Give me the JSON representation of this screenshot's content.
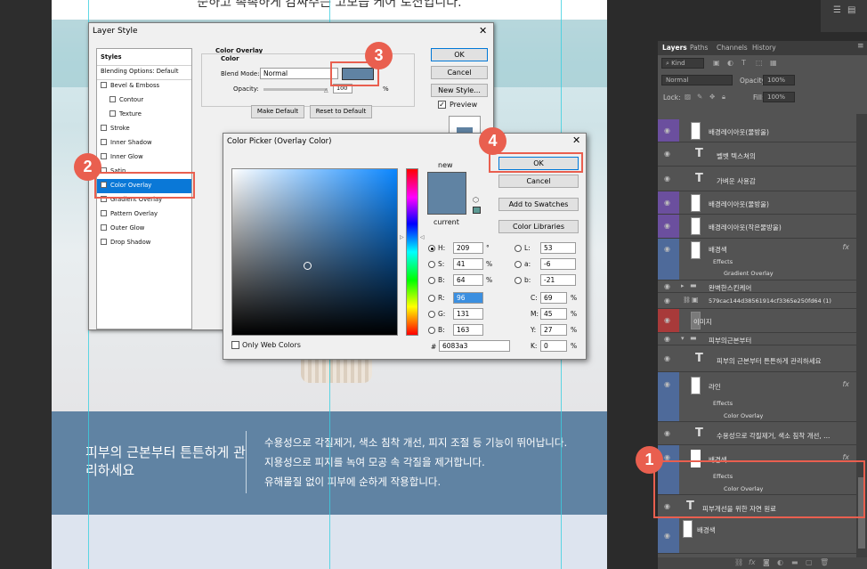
{
  "canvas": {
    "top_caption": "순하고 촉촉하게 감싸주는 고보습 케어 로션입니다.",
    "band_title": "피부의 근본부터 튼튼하게 관리하세요",
    "band_text": [
      "수용성으로 각질제거, 색소 침착 개선, 피지 조절 등 기능이 뛰어납니다.",
      "지용성으로 피지를 녹여 모공 속 각질을 제거합니다.",
      "유해물질 없이 피부에 순하게 작용합니다."
    ],
    "band_color": "#6083a3"
  },
  "layers_panel": {
    "tabs": [
      "Layers",
      "Paths",
      "Channels",
      "History"
    ],
    "kind_label": "Kind",
    "blend_mode": "Normal",
    "opacity_label": "Opacity:",
    "opacity_value": "100%",
    "lock_label": "Lock:",
    "fill_label": "Fill:",
    "fill_value": "100%",
    "layers": [
      {
        "name": "배경레이아웃(물방울)",
        "kind": "pixel",
        "stripe": "#6b4f9e"
      },
      {
        "name": "벨벳 텍스쳐의",
        "kind": "text"
      },
      {
        "name": "가벼운 사용감",
        "kind": "text"
      },
      {
        "name": "배경레이아웃(물방울)",
        "kind": "pixel",
        "stripe": "#6b4f9e"
      },
      {
        "name": "배경레이아웃(작은물방울)",
        "kind": "pixel",
        "stripe": "#6b4f9e"
      },
      {
        "name": "배경색",
        "kind": "pixel",
        "stripe": "#4e6a9a",
        "fx": "fx",
        "effects_label": "Effects",
        "effect": "Gradient Overlay"
      },
      {
        "name": "완벽한스킨케어",
        "kind": "folder"
      },
      {
        "name": "579cac144d38561914cf3365e250fd64 (1)",
        "kind": "smart"
      },
      {
        "name": "이미지",
        "kind": "pixel",
        "stripe": "#a83a3a"
      },
      {
        "name": "피부의근본부터",
        "kind": "folder-open"
      },
      {
        "name": "피부의 근본부터 튼튼하게 관리하세요",
        "kind": "text"
      },
      {
        "name": "라인",
        "kind": "pixel",
        "stripe": "#4e6a9a",
        "fx": "fx",
        "effects_label": "Effects",
        "effect": "Color Overlay"
      },
      {
        "name": "수용성으로 각질제거, 색소 침착 개선, ...",
        "kind": "text"
      },
      {
        "name": "배경색",
        "kind": "pixel",
        "stripe": "#4e6a9a",
        "fx": "fx",
        "effects_label": "Effects",
        "effect": "Color Overlay"
      },
      {
        "name": "피부개선을 위한 자연 원료",
        "kind": "text"
      },
      {
        "name": "배경색",
        "kind": "pixel",
        "stripe": "#4e6a9a"
      }
    ]
  },
  "layer_style": {
    "title": "Layer Style",
    "list": [
      {
        "label": "Styles",
        "check": false
      },
      {
        "label": "Blending Options: Default",
        "check": false
      },
      {
        "label": "Bevel & Emboss",
        "check": true
      },
      {
        "label": "Contour",
        "check": true,
        "indent": true
      },
      {
        "label": "Texture",
        "check": true,
        "indent": true
      },
      {
        "label": "Stroke",
        "check": true
      },
      {
        "label": "Inner Shadow",
        "check": true
      },
      {
        "label": "Inner Glow",
        "check": true
      },
      {
        "label": "Satin",
        "check": true
      },
      {
        "label": "Color Overlay",
        "check": true,
        "selected": true
      },
      {
        "label": "Gradient Overlay",
        "check": true
      },
      {
        "label": "Pattern Overlay",
        "check": true
      },
      {
        "label": "Outer Glow",
        "check": true
      },
      {
        "label": "Drop Shadow",
        "check": true
      }
    ],
    "group_title": "Color Overlay",
    "sub_title": "Color",
    "blend_mode_label": "Blend Mode:",
    "blend_mode_value": "Normal",
    "opacity_label": "Opacity:",
    "opacity_value": "100",
    "opacity_unit": "%",
    "overlay_color": "#6083a3",
    "make_default": "Make Default",
    "reset_default": "Reset to Default",
    "ok": "OK",
    "cancel": "Cancel",
    "new_style": "New Style...",
    "preview": "Preview"
  },
  "color_picker": {
    "title": "Color Picker (Overlay Color)",
    "new_label": "new",
    "current_label": "current",
    "ok": "OK",
    "cancel": "Cancel",
    "add_swatches": "Add to Swatches",
    "color_libraries": "Color Libraries",
    "only_web": "Only Web Colors",
    "H": "209",
    "H_unit": "°",
    "S": "41",
    "S_unit": "%",
    "Bv": "64",
    "B_unit": "%",
    "R": "96",
    "G": "131",
    "Bl": "163",
    "L": "53",
    "a": "-6",
    "b": "-21",
    "C": "69",
    "M": "45",
    "Y": "27",
    "K": "0",
    "hex": "6083a3",
    "new_color": "#6083a3",
    "current_color": "#6083a3"
  },
  "callouts": [
    "1",
    "2",
    "3",
    "4"
  ]
}
